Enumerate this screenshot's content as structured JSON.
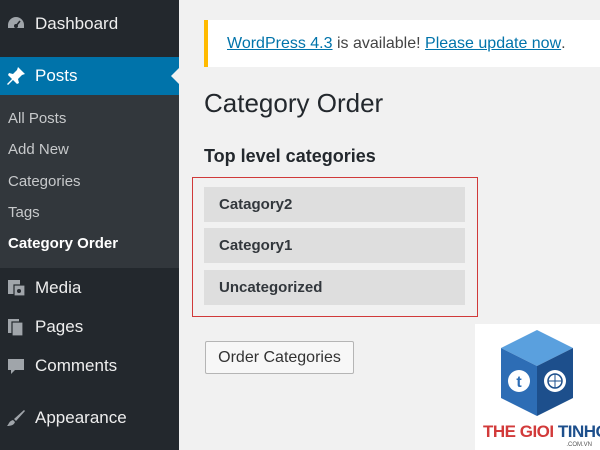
{
  "sidebar": {
    "dashboard": {
      "label": "Dashboard",
      "icon": "dashboard-icon"
    },
    "posts": {
      "label": "Posts",
      "icon": "pin-icon"
    },
    "posts_submenu": [
      {
        "label": "All Posts"
      },
      {
        "label": "Add New"
      },
      {
        "label": "Categories"
      },
      {
        "label": "Tags"
      },
      {
        "label": "Category Order",
        "current": true
      }
    ],
    "media": {
      "label": "Media",
      "icon": "media-icon"
    },
    "pages": {
      "label": "Pages",
      "icon": "pages-icon"
    },
    "comments": {
      "label": "Comments",
      "icon": "comment-icon"
    },
    "appearance": {
      "label": "Appearance",
      "icon": "brush-icon"
    }
  },
  "notice": {
    "link1": "WordPress 4.3",
    "text": " is available! ",
    "link2": "Please update now",
    "end": "."
  },
  "main": {
    "title": "Category Order",
    "section_title": "Top level categories",
    "categories": [
      "Catagory2",
      "Category1",
      "Uncategorized"
    ],
    "order_button": "Order Categories"
  },
  "watermark": {
    "text_red": "THE GIOI ",
    "text_blue": "TINHOC",
    "sub": ".COM.VN"
  },
  "colors": {
    "sidebar_bg": "#23282d",
    "submenu_bg": "#32373c",
    "accent": "#0073aa",
    "notice_border": "#ffba00",
    "highlight": "#d03a3a"
  }
}
